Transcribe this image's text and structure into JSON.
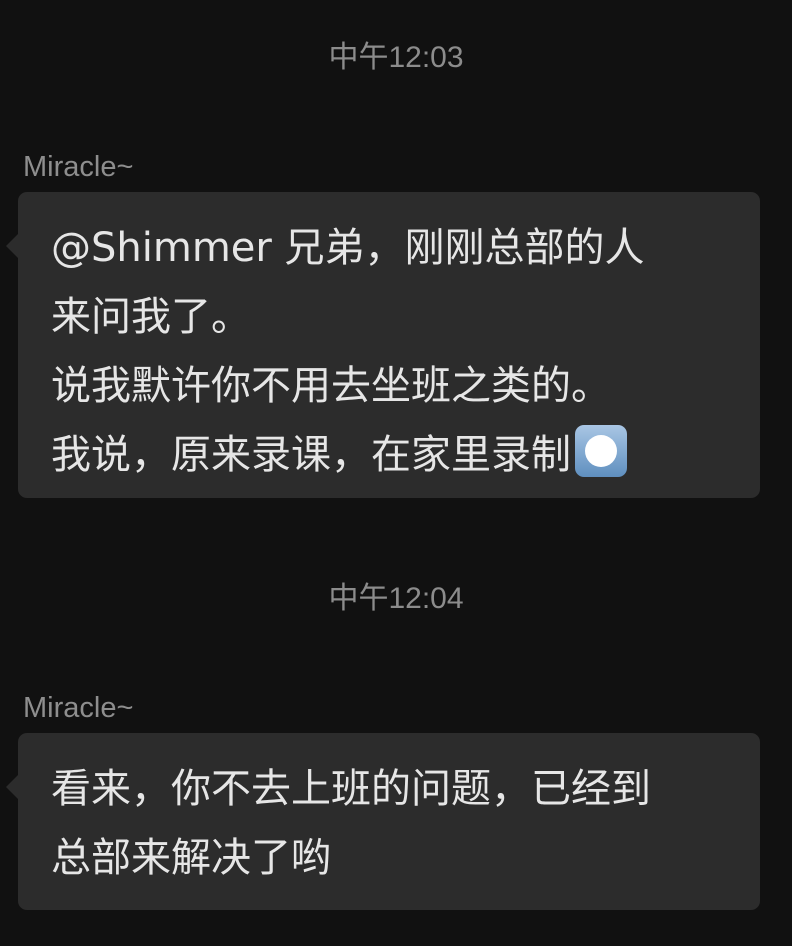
{
  "messages": [
    {
      "timestamp": "中午12:03",
      "sender": "Miracle~",
      "lines": [
        "@Shimmer 兄弟，刚刚总部的人",
        "来问我了。",
        "说我默许你不用去坐班之类的。",
        "我说，原来录课，在家里录制"
      ],
      "trailing_emoji": "white-circle-button-emoji"
    },
    {
      "timestamp": "中午12:04",
      "sender": "Miracle~",
      "lines": [
        "看来，你不去上班的问题，已经到",
        "总部来解决了哟"
      ]
    }
  ],
  "colors": {
    "background": "#111111",
    "bubble": "#2c2c2c",
    "message_text": "#e6e6e6",
    "meta_text": "#8c8c8c"
  }
}
